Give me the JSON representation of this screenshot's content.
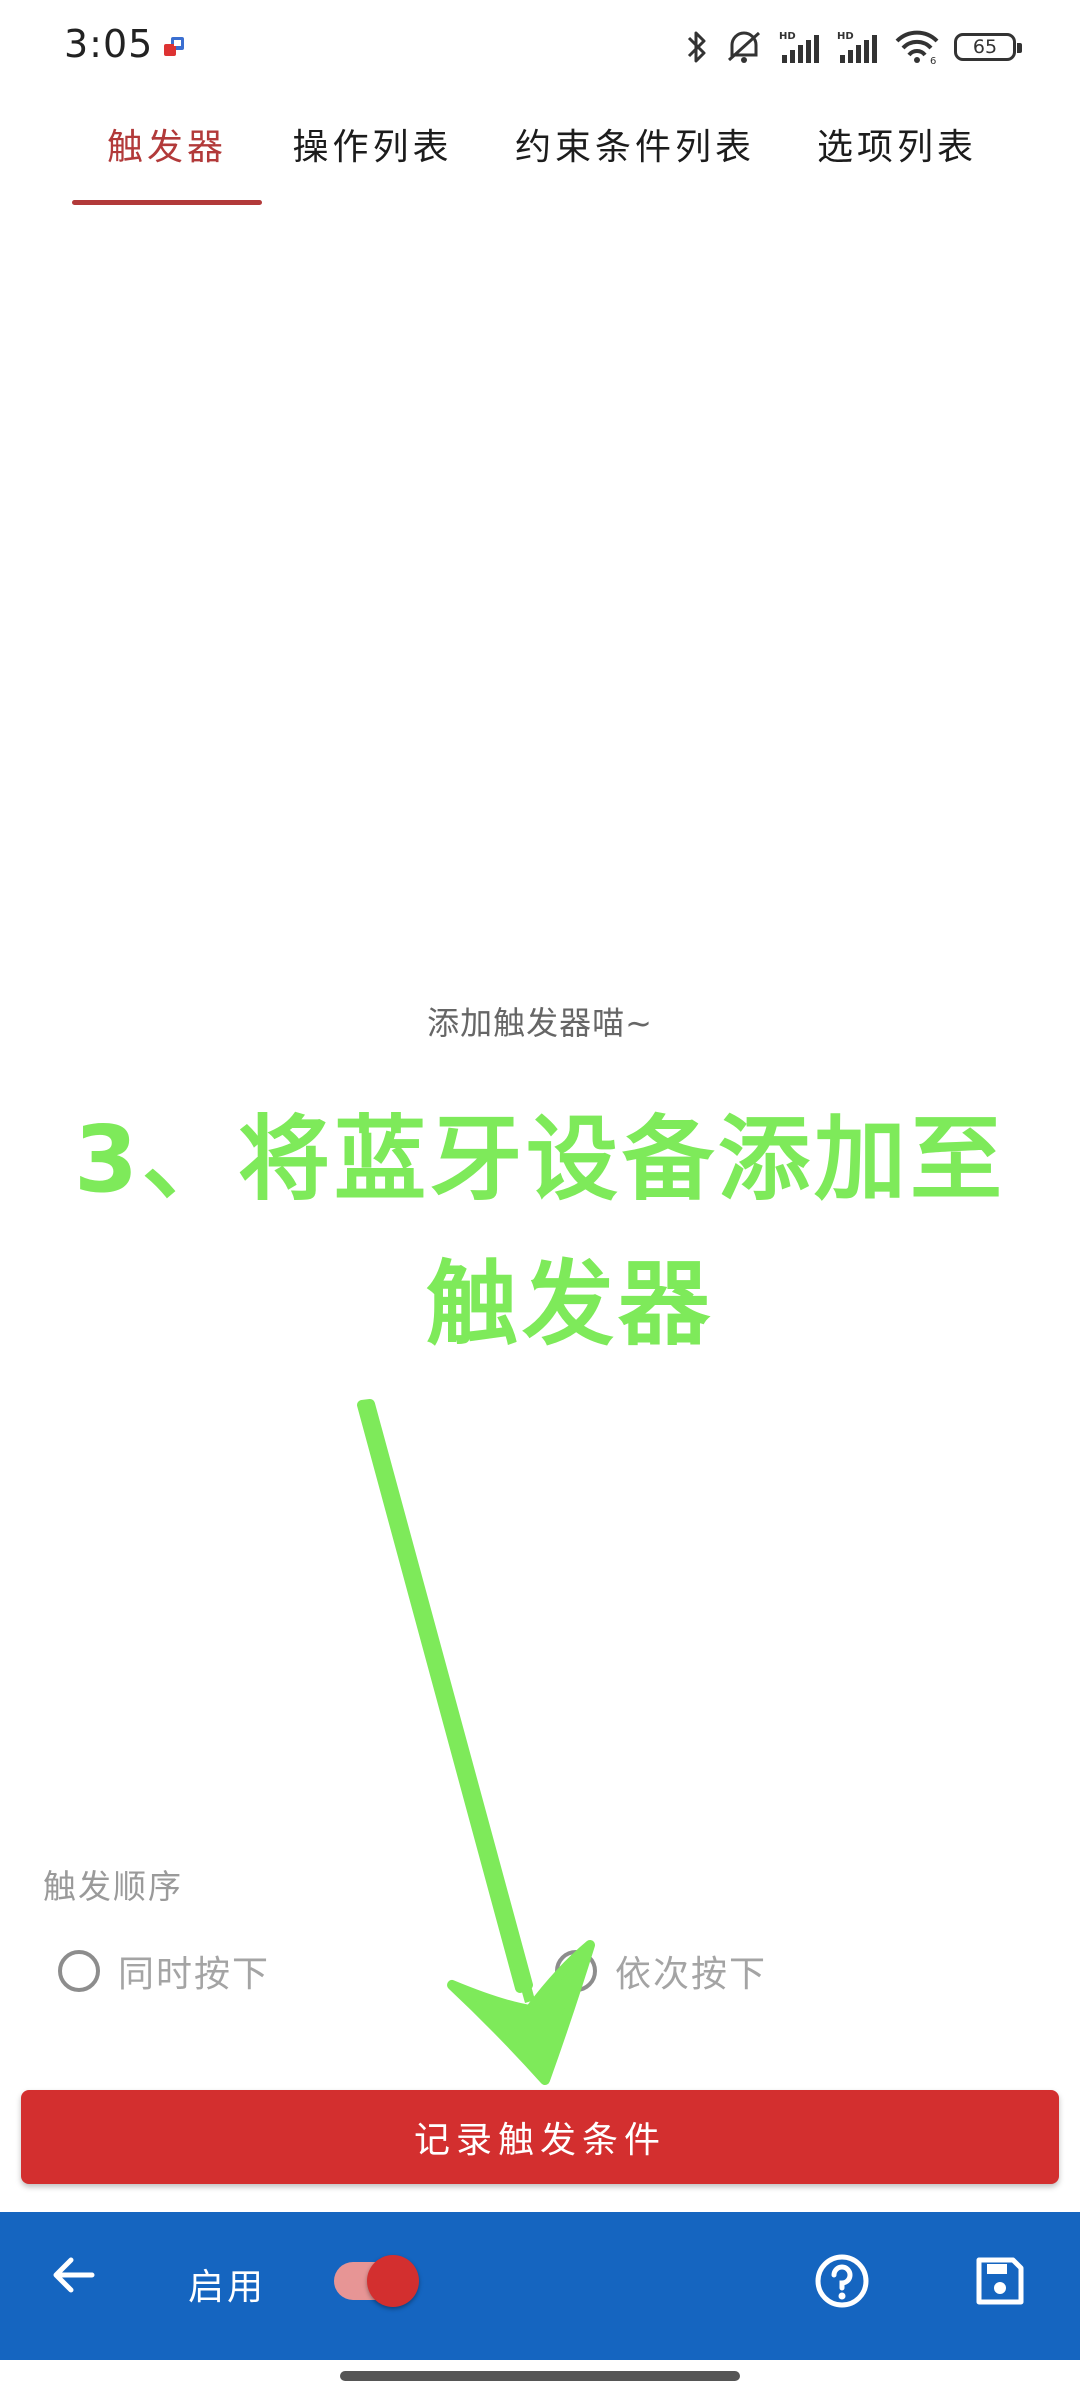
{
  "status_bar": {
    "time": "3:05",
    "icons": [
      "notification-app-icon",
      "bluetooth-icon",
      "mute-icon",
      "signal-hd-icon",
      "signal-hd-icon",
      "wifi-icon"
    ],
    "wifi_badge": "6",
    "battery": "65"
  },
  "tabs": [
    {
      "label": "触发器",
      "active": true
    },
    {
      "label": "操作列表",
      "active": false
    },
    {
      "label": "约束条件列表",
      "active": false
    },
    {
      "label": "选项列表",
      "active": false
    }
  ],
  "empty_state": "添加触发器喵~",
  "annotation": {
    "line1": "3、将蓝牙设备添加至",
    "line2": "触发器",
    "color": "#7eea5a"
  },
  "trigger_order": {
    "label": "触发顺序",
    "options": [
      "同时按下",
      "依次按下"
    ]
  },
  "record_button": "记录触发条件",
  "bottom_bar": {
    "enable_label": "启用",
    "enabled": true,
    "color": "#1565c0"
  },
  "accent_color": "#d32f2f"
}
